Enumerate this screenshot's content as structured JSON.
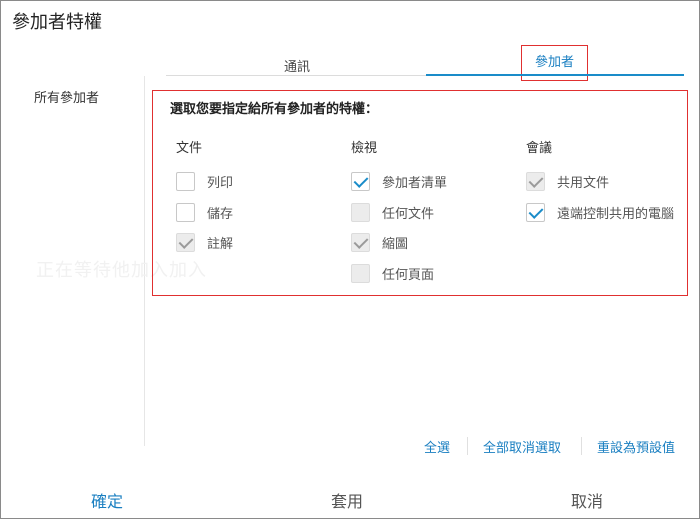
{
  "dialog": {
    "title": "參加者特權"
  },
  "sidebar": {
    "label": "所有參加者"
  },
  "tabs": [
    {
      "label": "通訊",
      "active": false
    },
    {
      "label": "參加者",
      "active": true
    }
  ],
  "permissions": {
    "prompt": "選取您要指定給所有參加者的特權：",
    "columns": [
      {
        "header": "文件",
        "items": [
          {
            "label": "列印",
            "checked": false,
            "disabled": false
          },
          {
            "label": "儲存",
            "checked": false,
            "disabled": false
          },
          {
            "label": "註解",
            "checked": true,
            "disabled": true
          }
        ]
      },
      {
        "header": "檢視",
        "items": [
          {
            "label": "參加者清單",
            "checked": true,
            "disabled": false
          },
          {
            "label": "任何文件",
            "checked": false,
            "disabled": true
          },
          {
            "label": "縮圖",
            "checked": true,
            "disabled": true
          },
          {
            "label": "任何頁面",
            "checked": false,
            "disabled": true
          }
        ]
      },
      {
        "header": "會議",
        "items": [
          {
            "label": "共用文件",
            "checked": true,
            "disabled": true
          },
          {
            "label": "遠端控制共用的電腦",
            "checked": true,
            "disabled": false
          }
        ]
      }
    ]
  },
  "ghost_text": "正在等待他加入加入",
  "links": {
    "select_all": "全選",
    "deselect_all": "全部取消選取",
    "reset_default": "重設為預設值"
  },
  "footer": {
    "ok": "確定",
    "apply": "套用",
    "cancel": "取消"
  },
  "colors": {
    "accent": "#1a8cc9",
    "highlight_border": "#e03030"
  }
}
